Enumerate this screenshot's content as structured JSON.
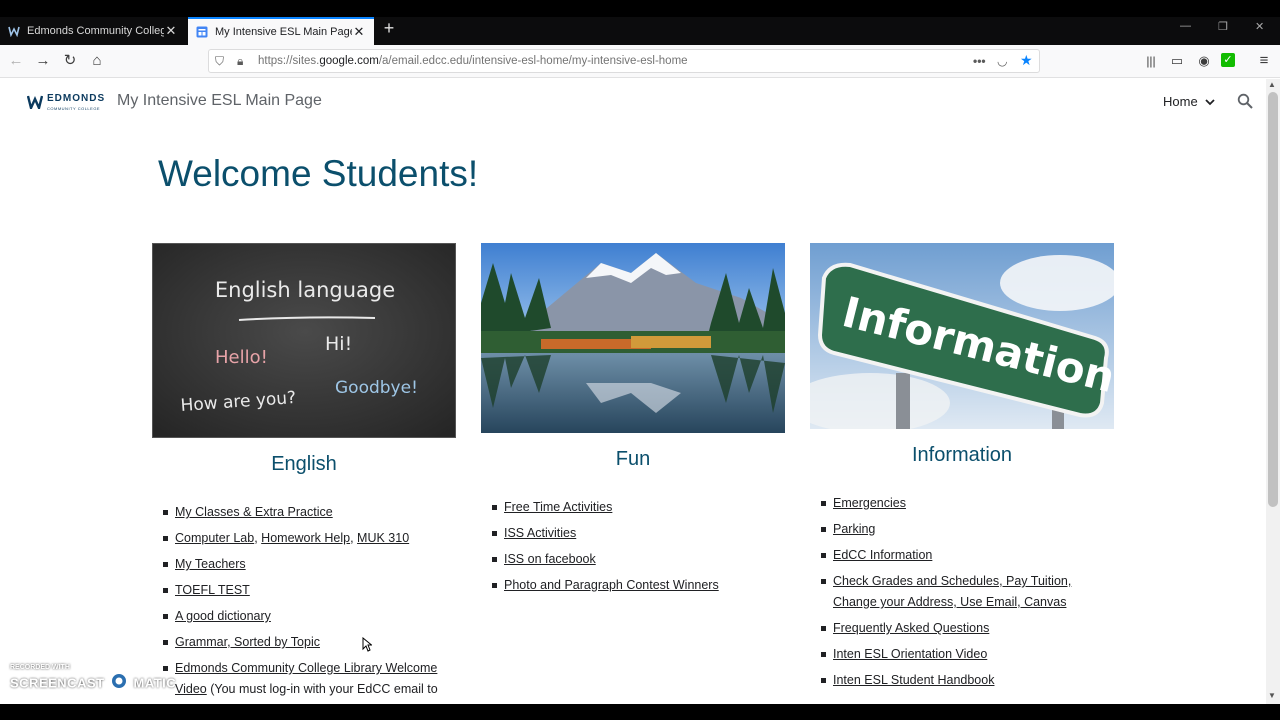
{
  "browser": {
    "tabs": [
      {
        "label": "Edmonds Community College",
        "active": false
      },
      {
        "label": "My Intensive ESL Main Page",
        "active": true
      }
    ],
    "url_prefix": "https://sites.",
    "url_domain": "google.com",
    "url_path": "/a/email.edcc.edu/intensive-esl-home/my-intensive-esl-home"
  },
  "site": {
    "logo_text": "EDMONDS",
    "logo_sub": "COMMUNITY COLLEGE",
    "title": "My Intensive ESL Main Page",
    "nav_home": "Home"
  },
  "main": {
    "heading": "Welcome Students!",
    "columns": [
      {
        "heading": "English",
        "image_text": [
          "English language",
          "Hello!",
          "Hi!",
          "How are you?",
          "Goodbye!"
        ],
        "links": [
          "My Classes & Extra Practice",
          "Computer Lab",
          "Homework Help",
          "MUK 310",
          "My Teachers",
          "TOEFL TEST",
          "A good dictionary",
          "Grammar, Sorted by Topic",
          "Edmonds Community College Library Welcome Video",
          "(You must log-in with your EdCC email to"
        ]
      },
      {
        "heading": "Fun",
        "links": [
          "Free Time Activities",
          "ISS Activities",
          "ISS on facebook",
          "Photo and Paragraph Contest Winners"
        ]
      },
      {
        "heading": "Information",
        "image_text": "Information",
        "links": [
          "Emergencies",
          "Parking",
          "EdCC Information",
          "Check Grades and Schedules, Pay Tuition, Change your Address, Use Email, Canvas",
          "Frequently Asked Questions",
          "Inten ESL Orientation Video",
          "Inten ESL Student Handbook"
        ]
      }
    ]
  },
  "watermark": {
    "line1": "RECORDED WITH",
    "line2": "SCREENCAST",
    "line3": "MATIC"
  },
  "colors": {
    "heading": "#0b4f6c",
    "tab_accent": "#0a84ff",
    "logo": "#0b3a5e"
  }
}
